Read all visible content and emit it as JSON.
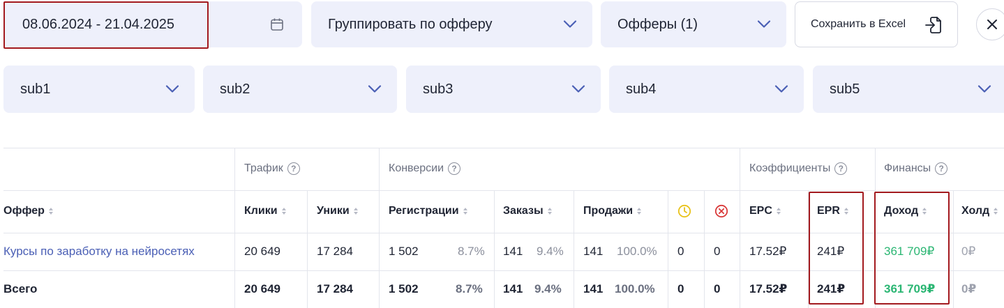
{
  "filters": {
    "date_range": "08.06.2024 - 21.04.2025",
    "group_by": "Группировать по офферу",
    "offers": "Офферы (1)",
    "export_label": "Сохранить в Excel",
    "subs": [
      "sub1",
      "sub2",
      "sub3",
      "sub4",
      "sub5"
    ]
  },
  "table": {
    "groups": {
      "traffic": "Трафик",
      "conversions": "Конверсии",
      "coefficients": "Коэффициенты",
      "finance": "Финансы"
    },
    "columns": {
      "offer": "Оффер",
      "clicks": "Клики",
      "uniques": "Уники",
      "registrations": "Регистрации",
      "orders": "Заказы",
      "sales": "Продажи",
      "epc": "EPC",
      "epr": "EPR",
      "income": "Доход",
      "hold": "Холд"
    },
    "rows": [
      {
        "offer": "Курсы по заработку на нейросетях",
        "clicks": "20 649",
        "uniques": "17 284",
        "registrations": "1 502",
        "registrations_pct": "8.7%",
        "orders": "141",
        "orders_pct": "9.4%",
        "sales": "141",
        "sales_pct": "100.0%",
        "pending": "0",
        "rejected": "0",
        "epc": "17.52₽",
        "epr": "241₽",
        "income": "361 709₽",
        "hold": "0₽"
      }
    ],
    "total": {
      "label": "Всего",
      "clicks": "20 649",
      "uniques": "17 284",
      "registrations": "1 502",
      "registrations_pct": "8.7%",
      "orders": "141",
      "orders_pct": "9.4%",
      "sales": "141",
      "sales_pct": "100.0%",
      "pending": "0",
      "rejected": "0",
      "epc": "17.52₽",
      "epr": "241₽",
      "income": "361 709₽",
      "hold": "0₽"
    }
  },
  "colors": {
    "field_bg": "#eef0fb",
    "accent": "#4a5fb5",
    "positive": "#2bb673",
    "pending_icon": "#e8c21a",
    "rejected_icon": "#d93a3a",
    "highlight": "#a31a1f"
  },
  "icons": [
    "calendar-icon",
    "chevron-down-icon",
    "export-icon",
    "close-icon",
    "help-icon",
    "sort-icon",
    "clock-icon",
    "cancel-circle-icon"
  ]
}
